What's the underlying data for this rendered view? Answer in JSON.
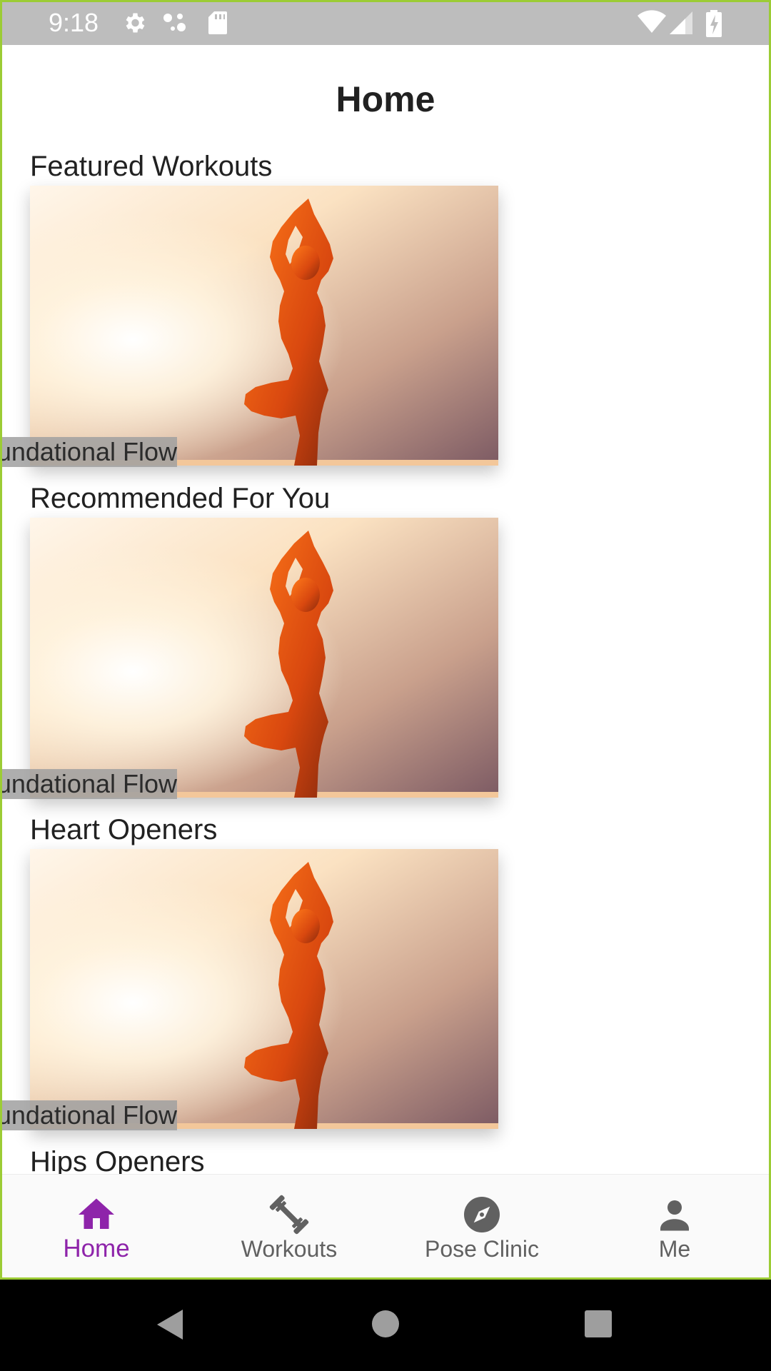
{
  "status_bar": {
    "time": "9:18"
  },
  "app_bar": {
    "title": "Home"
  },
  "sections": [
    {
      "title": "Featured Workouts",
      "card_caption": "Foundational Flow"
    },
    {
      "title": "Recommended For You",
      "card_caption": "Foundational Flow"
    },
    {
      "title": "Heart Openers",
      "card_caption": "Foundational Flow"
    },
    {
      "title": "Hips Openers",
      "card_caption": ""
    }
  ],
  "bottom_nav": {
    "items": [
      {
        "label": "Home",
        "icon": "home-icon",
        "active": true
      },
      {
        "label": "Workouts",
        "icon": "dumbbell-icon",
        "active": false
      },
      {
        "label": "Pose Clinic",
        "icon": "compass-icon",
        "active": false
      },
      {
        "label": "Me",
        "icon": "person-icon",
        "active": false
      }
    ]
  },
  "colors": {
    "accent": "#8e24aa",
    "status_bar": "#bdbdbd",
    "frame": "#9ccc35"
  }
}
